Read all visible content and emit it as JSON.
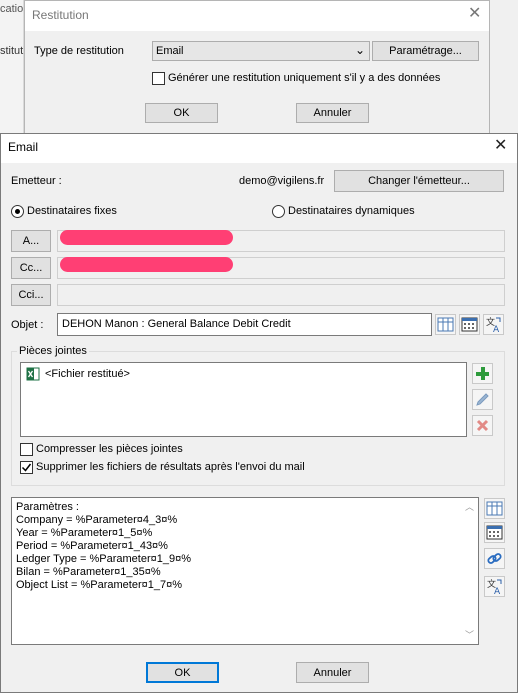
{
  "bg_window": {
    "left_texts": [
      "cation",
      "stituti"
    ]
  },
  "restitution_dialog": {
    "title": "Restitution",
    "type_label": "Type de restitution",
    "type_value": "Email",
    "parametrage_button": "Paramétrage...",
    "only_if_data_label": "Générer une restitution uniquement s'il y a des données",
    "only_if_data_checked": false,
    "ok_button": "OK",
    "cancel_button": "Annuler"
  },
  "email_dialog": {
    "title": "Email",
    "sender_label": "Emetteur :",
    "sender_value": "demo@vigilens.fr",
    "change_sender_button": "Changer l'émetteur...",
    "radio_fixed_label": "Destinataires fixes",
    "radio_fixed_selected": true,
    "radio_dynamic_label": "Destinataires dynamiques",
    "to_button": "A...",
    "cc_button": "Cc...",
    "bcc_button": "Cci...",
    "subject_label": "Objet :",
    "subject_value": "DEHON Manon : General Balance Debit Credit",
    "attachments_group": "Pièces jointes",
    "attachment_item": "<Fichier restitué>",
    "compress_label": "Compresser les pièces jointes",
    "compress_checked": false,
    "delete_label": "Supprimer les fichiers de résultats après l'envoi du mail",
    "delete_checked": true,
    "body_lines": [
      "Paramètres :",
      "Company = %Parameter¤4_3¤%",
      "Year = %Parameter¤1_5¤%",
      "Period = %Parameter¤1_43¤%",
      "Ledger Type = %Parameter¤1_9¤%",
      "Bilan = %Parameter¤1_35¤%",
      "Object List = %Parameter¤1_7¤%"
    ],
    "ok_button": "OK",
    "cancel_button": "Annuler"
  },
  "colors": {
    "accent": "#0078d7",
    "redaction": "#ff3f74",
    "add_green": "#2e9b3c",
    "delete_red": "#d9534f"
  }
}
